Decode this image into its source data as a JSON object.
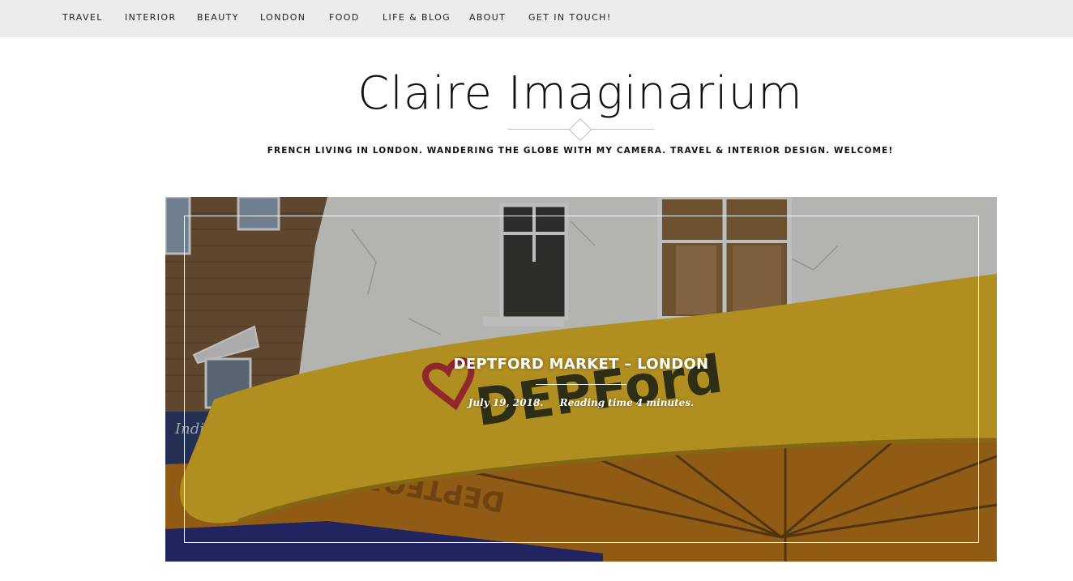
{
  "nav": {
    "items": [
      {
        "label": "TRAVEL"
      },
      {
        "label": "INTERIOR"
      },
      {
        "label": "BEAUTY"
      },
      {
        "label": "LONDON"
      },
      {
        "label": "FOOD"
      },
      {
        "label": "LIFE & BLOG"
      },
      {
        "label": "ABOUT"
      },
      {
        "label": "GET IN TOUCH!"
      }
    ]
  },
  "header": {
    "title": "Claire Imaginarium",
    "tagline": "FRENCH LIVING IN LONDON. WANDERING THE GLOBE WITH MY CAMERA. TRAVEL & INTERIOR DESIGN. WELCOME!"
  },
  "featured_post": {
    "title": "DEPTFORD MARKET – LONDON",
    "date": "July 19, 2018.",
    "reading_time": "Reading time 4 minutes.",
    "image_text": {
      "awning_word": "DEPFord",
      "awning_reflection": "DEPTFORD",
      "shop_sign": "Indian"
    }
  },
  "colors": {
    "nav_background": "#ececec",
    "divider_accent": "#d5b6b0",
    "awning_yellow": "#e3b72a",
    "awning_underside": "#c9821f"
  }
}
